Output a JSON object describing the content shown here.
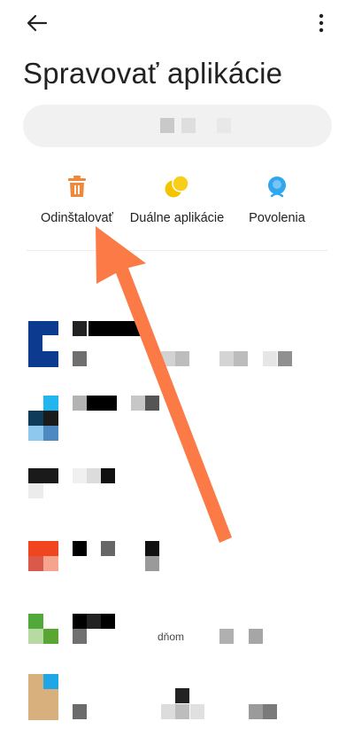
{
  "header": {
    "back_icon": "arrow-left-icon",
    "more_icon": "more-vertical-icon",
    "title": "Spravovať aplikácie"
  },
  "search": {
    "value": "",
    "icon": "search-icon"
  },
  "actions": [
    {
      "label": "Odinštalovať",
      "icon": "trash-icon",
      "color": "#f0883a"
    },
    {
      "label": "Duálne aplikácie",
      "icon": "dual-apps-icon",
      "color": "#f5c400"
    },
    {
      "label": "Povolenia",
      "icon": "permissions-icon",
      "color": "#2fa6f0"
    }
  ],
  "annotation": {
    "icon": "pointer-arrow-icon",
    "color": "#fb7a45"
  },
  "app_list": {
    "row5_partial_text": "dňom"
  },
  "colors": {
    "background": "#ffffff",
    "search_bg": "#f1f1f1",
    "divider": "#ececec"
  }
}
